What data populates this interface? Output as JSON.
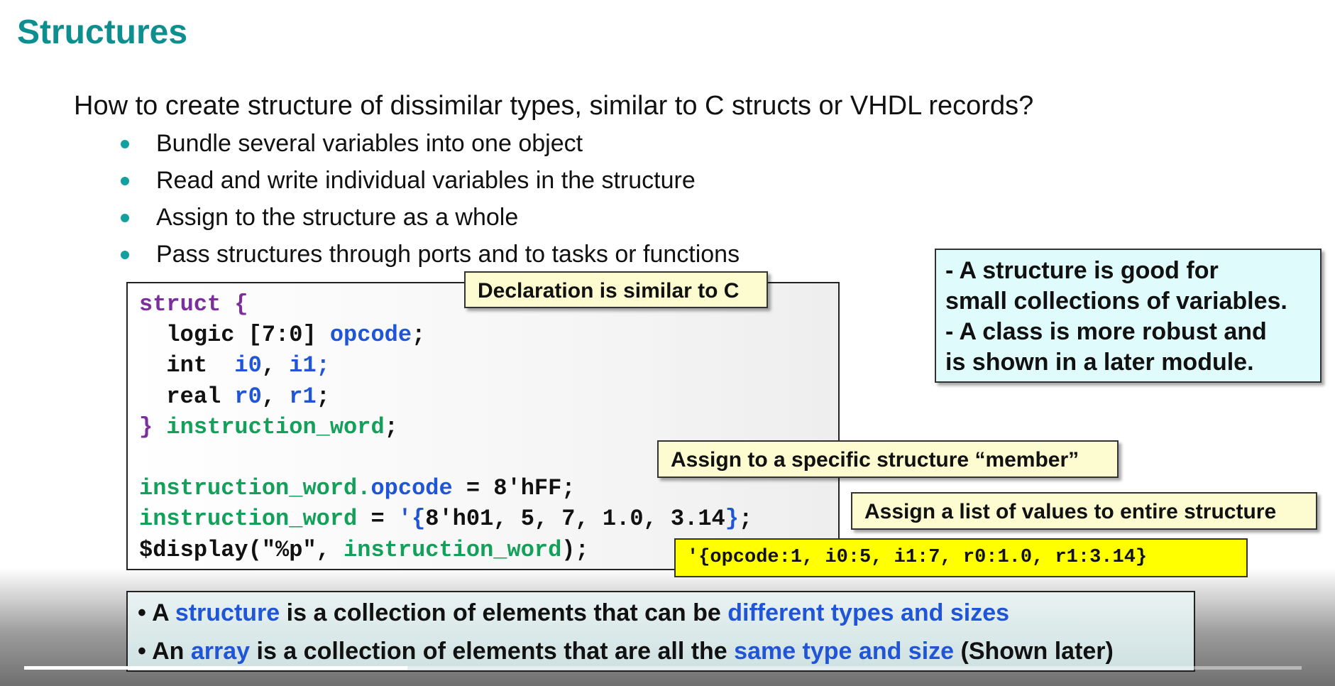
{
  "slide": {
    "title": "Structures",
    "question": "How to create structure of dissimilar types, similar to C structs or VHDL records?",
    "bullets": [
      "Bundle several variables into one object",
      "Read and write individual variables in the structure",
      "Assign to the structure as a whole",
      "Pass structures through ports and to tasks or functions"
    ]
  },
  "code": {
    "l1_kw": "struct {",
    "l2_a": "  logic [7:0] ",
    "l2_b": "opcode",
    "l2_c": ";",
    "l3_a": "  int  ",
    "l3_b": "i0",
    "l3_c": ", ",
    "l3_d": "i1;",
    "l4_a": "  real ",
    "l4_b": "r0",
    "l4_c": ", ",
    "l4_d": "r1",
    "l4_e": ";",
    "l5_a": "} ",
    "l5_b": "instruction_word",
    "l5_c": ";",
    "l7_a": "instruction_word.",
    "l7_b": "opcode",
    "l7_c": " = 8'hFF;",
    "l8_a": "instruction_word",
    "l8_b": " = ",
    "l8_c": "'{",
    "l8_d": "8'h01, 5, 7, 1.0, 3.14",
    "l8_e": "}",
    "l8_f": ";",
    "l9_a": "$display(\"%p\", ",
    "l9_b": "instruction_word",
    "l9_c": ");"
  },
  "notes": {
    "declaration": "Declaration is similar to C",
    "member": "Assign to a specific structure “member”",
    "list": "Assign a list of values to entire structure",
    "output": "'{opcode:1, i0:5, i1:7, r0:1.0, r1:3.14}"
  },
  "infobox": {
    "line1": "- A structure is good for",
    "line2": "small collections of variables.",
    "line3": "- A class is more robust and",
    "line4": "is shown in a later module."
  },
  "summary": {
    "l1_bullet": "• A ",
    "l1_hl1": "structure",
    "l1_mid": " is a collection of elements that can be ",
    "l1_hl2": "different types and sizes",
    "l2_bullet": "• An ",
    "l2_hl1": "array",
    "l2_mid": " is a collection of elements that are all the ",
    "l2_hl2": "same type and size",
    "l2_end": " (Shown later)"
  },
  "video": {
    "progress": 0.3
  },
  "colors": {
    "title": "#0e8f8f",
    "keyword": "#7b2f9d",
    "identifier_blue": "#1f55d6",
    "identifier_green": "#13a05a",
    "note_bg": "#fdfbd0",
    "output_bg": "#ffff00",
    "info_bg": "#dffbfb"
  }
}
